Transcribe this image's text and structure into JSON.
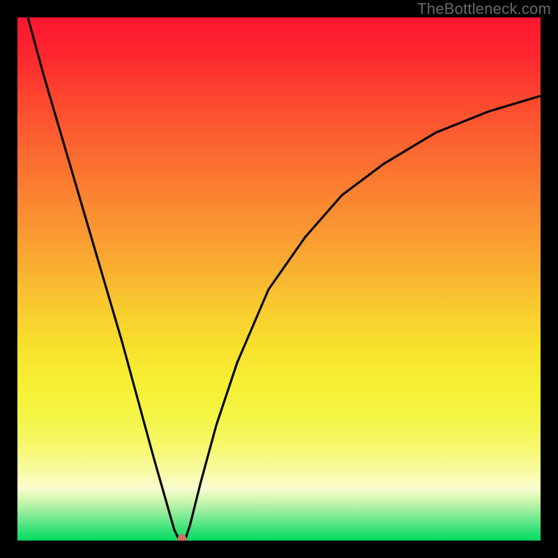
{
  "watermark": "TheBottleneck.com",
  "chart_data": {
    "type": "line",
    "title": "",
    "xlabel": "",
    "ylabel": "",
    "xlim": [
      0,
      100
    ],
    "ylim": [
      0,
      100
    ],
    "series": [
      {
        "name": "curve",
        "x": [
          2,
          5,
          10,
          15,
          20,
          23,
          26,
          28,
          30,
          31,
          32,
          33,
          35,
          38,
          42,
          48,
          55,
          62,
          70,
          80,
          90,
          100
        ],
        "y": [
          100,
          89,
          72,
          55,
          38,
          27,
          16,
          9,
          2,
          0,
          0,
          3,
          11,
          22,
          34,
          48,
          58,
          66,
          72,
          78,
          82,
          85
        ]
      }
    ],
    "marker": {
      "x": 31.5,
      "y": 0
    },
    "background_gradient": {
      "stops": [
        {
          "pos": 0.0,
          "color": "#fd1530"
        },
        {
          "pos": 0.25,
          "color": "#fb6730"
        },
        {
          "pos": 0.55,
          "color": "#f8c92f"
        },
        {
          "pos": 0.75,
          "color": "#f5f55a"
        },
        {
          "pos": 0.92,
          "color": "#c9f4a5"
        },
        {
          "pos": 1.0,
          "color": "#04da63"
        }
      ]
    }
  }
}
